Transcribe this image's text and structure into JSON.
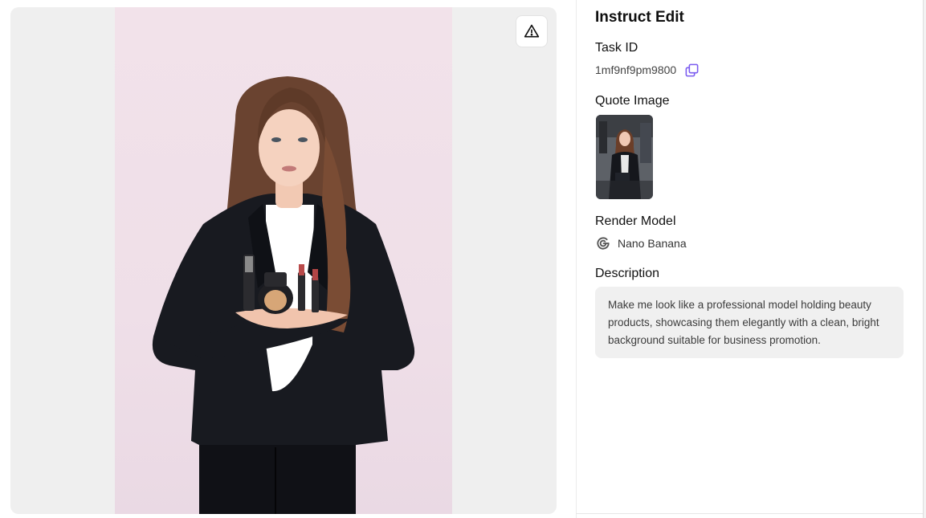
{
  "panel": {
    "title": "Instruct Edit",
    "task_id_label": "Task ID",
    "task_id_value": "1mf9nf9pm9800",
    "quote_image_label": "Quote Image",
    "render_model_label": "Render Model",
    "render_model_name": "Nano Banana",
    "description_label": "Description",
    "description_text": "Make me look like a professional model holding beauty products, showcasing them elegantly with a clean, bright background suitable for business promotion."
  },
  "icons": {
    "report": "warning-triangle-icon",
    "copy": "copy-icon",
    "model": "google-g-icon"
  },
  "colors": {
    "accent": "#7b5cf0",
    "preview_bg": "#efefef",
    "desc_bg": "#f0f0f0"
  }
}
